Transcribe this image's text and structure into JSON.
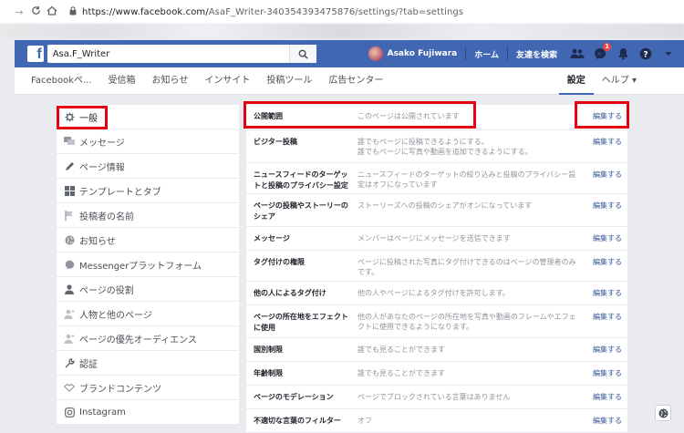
{
  "browser": {
    "url_host": "https://www.facebook.com/",
    "url_path": "AsaF_Writer-340354393475876/settings/?tab=settings"
  },
  "header": {
    "search_value": "Asa.F_Writer",
    "user_name": "Asako Fujiwara",
    "home_label": "ホーム",
    "find_friends_label": "友達を検索",
    "messenger_badge": "1"
  },
  "tabs": [
    {
      "label": "Facebookペ..."
    },
    {
      "label": "受信箱"
    },
    {
      "label": "お知らせ"
    },
    {
      "label": "インサイト"
    },
    {
      "label": "投稿ツール"
    },
    {
      "label": "広告センター"
    },
    {
      "label": "設定"
    },
    {
      "label": "ヘルプ ▾"
    }
  ],
  "sidebar": {
    "items": [
      {
        "label": "一般"
      },
      {
        "label": "メッセージ"
      },
      {
        "label": "ページ情報"
      },
      {
        "label": "テンプレートとタブ"
      },
      {
        "label": "投稿者の名前"
      },
      {
        "label": "お知らせ"
      },
      {
        "label": "Messengerプラットフォーム"
      },
      {
        "label": "ページの役割"
      },
      {
        "label": "人物と他のページ"
      },
      {
        "label": "ページの優先オーディエンス"
      },
      {
        "label": "認証"
      },
      {
        "label": "ブランドコンテンツ"
      },
      {
        "label": "Instagram"
      }
    ]
  },
  "settings": {
    "edit_label": "編集する",
    "rows": [
      {
        "name": "公開範囲",
        "desc": "このページは公開されています"
      },
      {
        "name": "ビジター投稿",
        "desc": "誰でもページに投稿できるようにする。\n誰でもページに写真や動画を追加できるようにする。"
      },
      {
        "name": "ニュースフィードのターゲットと投稿のプライバシー設定",
        "desc": "ニュースフィードのターゲットの絞り込みと投稿のプライバシー設定はオフになっています"
      },
      {
        "name": "ページの投稿やストーリーのシェア",
        "desc": "ストーリーズへの投稿のシェアがオンになっています"
      },
      {
        "name": "メッセージ",
        "desc": "メンバーはページにメッセージを送信できます"
      },
      {
        "name": "タグ付けの権限",
        "desc": "ページに投稿された写真にタグ付けできるのはページの管理者のみです。"
      },
      {
        "name": "他の人によるタグ付け",
        "desc": "他の人やページによるタグ付けを許可します。"
      },
      {
        "name": "ページの所在地をエフェクトに使用",
        "desc": "他の人があなたのページの所在地を写真や動画のフレームやエフェクトに使用できるようになります。"
      },
      {
        "name": "国別制限",
        "desc": "誰でも見ることができます"
      },
      {
        "name": "年齢制限",
        "desc": "誰でも見ることができます"
      },
      {
        "name": "ページのモデレーション",
        "desc": "ページでブロックされている言葉はありません"
      },
      {
        "name": "不適切な言葉のフィルター",
        "desc": "オフ"
      }
    ]
  },
  "colors": {
    "fb_blue": "#4267b2",
    "link_blue": "#365899",
    "highlight_red": "#e3000f"
  }
}
